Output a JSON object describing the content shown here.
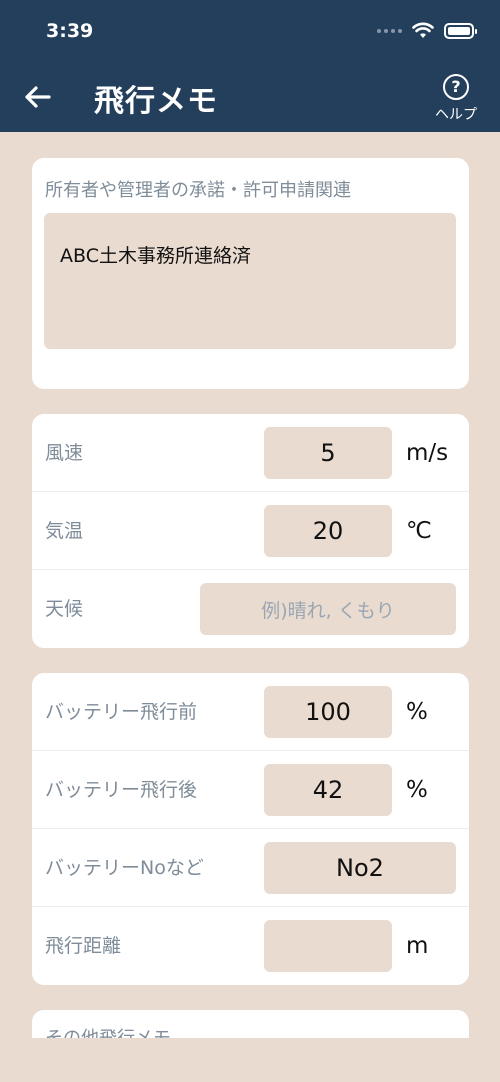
{
  "status_bar": {
    "time": "3:39"
  },
  "header": {
    "title": "飛行メモ",
    "help_label": "ヘルプ",
    "help_symbol": "?",
    "back_icon": "arrow-left-icon"
  },
  "notes": {
    "label": "所有者や管理者の承諾・許可申請関連",
    "value": "ABC土木事務所連絡済"
  },
  "weather": {
    "wind": {
      "label": "風速",
      "value": "5",
      "unit": "m/s"
    },
    "temperature": {
      "label": "気温",
      "value": "20",
      "unit": "℃"
    },
    "condition": {
      "label": "天候",
      "value": "",
      "placeholder": "例)晴れ, くもり"
    }
  },
  "battery": {
    "before": {
      "label": "バッテリー飛行前",
      "value": "100",
      "unit": "%"
    },
    "after": {
      "label": "バッテリー飛行後",
      "value": "42",
      "unit": "%"
    },
    "number": {
      "label": "バッテリーNoなど",
      "value": "No2"
    },
    "distance": {
      "label": "飛行距離",
      "value": "",
      "unit": "m"
    }
  },
  "other": {
    "label": "その他飛行メモ"
  },
  "colors": {
    "header_bg": "#243f5c",
    "page_bg": "#eadbd0",
    "field_bg": "#eadbd0",
    "label_text": "#7f8c99"
  }
}
